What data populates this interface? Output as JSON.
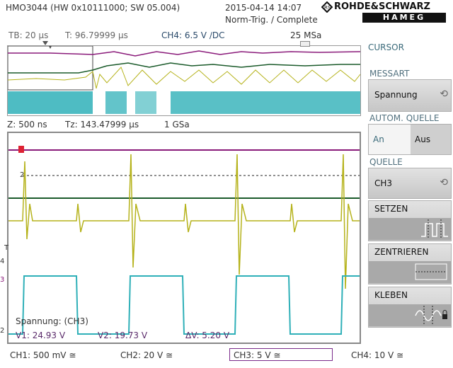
{
  "header": {
    "device": "HMO3044 (HW 0x10111000; SW 05.004)",
    "datetime": "2015-04-14 14:07",
    "trigger_mode": "Norm-Trig. / Complete",
    "brand_top": "ROHDE&SCHWARZ",
    "brand_bottom": "HAMEG"
  },
  "status_line": {
    "tb": "TB: 20 µs",
    "t": "T: 96.79999 µs",
    "ch4": "CH4: 6.5 V ∕DC",
    "rate": "25 MSa"
  },
  "zoom_line": {
    "z": "Z: 500 ns",
    "tz": "Tz: 143.47999 µs",
    "rate": "1 GSa"
  },
  "menu": {
    "title": "CURSOR",
    "messart_title": "MESSART",
    "messart_value": "Spannung",
    "autom_title": "AUTOM. QUELLE",
    "autom_on": "An",
    "autom_off": "Aus",
    "quelle_title": "QUELLE",
    "quelle_value": "CH3",
    "setzen": "SETZEN",
    "zentrieren": "ZENTRIEREN",
    "kleben": "KLEBEN"
  },
  "readout": {
    "label": "Spannung: (CH3)",
    "v1": "V1: 24.93 V",
    "v2": "V2: 19.73 V",
    "dv": "ΔV: 5.20 V"
  },
  "markers": {
    "m4": "4",
    "mT": "T",
    "m3": "3",
    "m2": "2",
    "m2b": "2"
  },
  "footer": {
    "ch1": "CH1: 500 mV ≅",
    "ch2": "CH2: 20 V ≅",
    "ch3": "CH3: 5 V ≅",
    "ch4": "CH4: 10 V ≅"
  },
  "colors": {
    "ch1": "#b5b21a",
    "ch2": "#1a5a2a",
    "ch3": "#2fb0b8",
    "ch4": "#8a1a7a"
  }
}
